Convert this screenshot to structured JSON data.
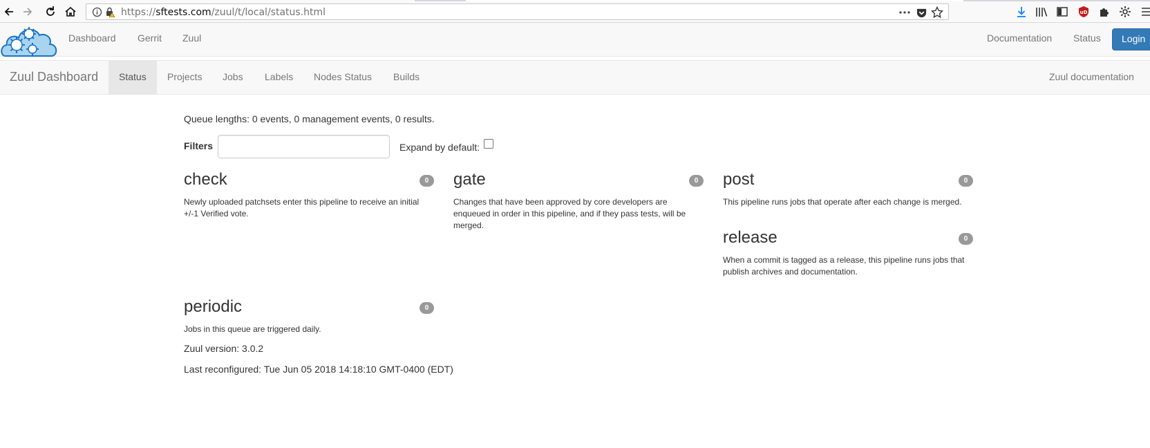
{
  "browser": {
    "url_prefix": "https://",
    "url_host": "sftests.com",
    "url_path": "/zuul/t/local/status.html"
  },
  "topnav": {
    "items": [
      {
        "label": "Dashboard"
      },
      {
        "label": "Gerrit"
      },
      {
        "label": "Zuul"
      }
    ],
    "right_items": [
      {
        "label": "Documentation"
      },
      {
        "label": "Status"
      }
    ],
    "login_label": "Login"
  },
  "zuulnav": {
    "brand": "Zuul Dashboard",
    "tabs": [
      {
        "label": "Status",
        "active": true
      },
      {
        "label": "Projects"
      },
      {
        "label": "Jobs"
      },
      {
        "label": "Labels"
      },
      {
        "label": "Nodes Status"
      },
      {
        "label": "Builds"
      }
    ],
    "docs_label": "Zuul documentation"
  },
  "status": {
    "queue_lengths": "Queue lengths: 0 events, 0 management events, 0 results.",
    "filters_label": "Filters",
    "filters_value": "",
    "expand_label": "Expand by default:",
    "expand_checked": false
  },
  "pipelines": [
    {
      "name": "check",
      "count": "0",
      "description": "Newly uploaded patchsets enter this pipeline to receive an initial +/-1 Verified vote."
    },
    {
      "name": "gate",
      "count": "0",
      "description": "Changes that have been approved by core developers are enqueued in order in this pipeline, and if they pass tests, will be merged."
    },
    {
      "name": "post",
      "count": "0",
      "description": "This pipeline runs jobs that operate after each change is merged."
    },
    {
      "name": "release",
      "count": "0",
      "description": "When a commit is tagged as a release, this pipeline runs jobs that publish archives and documentation."
    },
    {
      "name": "periodic",
      "count": "0",
      "description": "Jobs in this queue are triggered daily."
    }
  ],
  "footer": {
    "version": "Zuul version: 3.0.2",
    "reconfigured": "Last reconfigured: Tue Jun 05 2018 14:18:10 GMT-0400 (EDT)"
  },
  "colors": {
    "login_bg": "#337ab7",
    "badge_bg": "#999999",
    "logo_cloud": "#a8d4f0",
    "logo_outline": "#1a73c7",
    "download_icon": "#0a84ff",
    "ublock_icon": "#c41a1a"
  },
  "icons": [
    "back-icon",
    "forward-icon",
    "reload-icon",
    "home-icon",
    "info-icon",
    "insecure-lock-icon",
    "page-actions-icon",
    "pocket-icon",
    "bookmark-star-icon",
    "download-icon",
    "library-icon",
    "sidebar-icon",
    "ublock-icon",
    "extension-icon",
    "settings-gear-icon",
    "menu-icon"
  ]
}
